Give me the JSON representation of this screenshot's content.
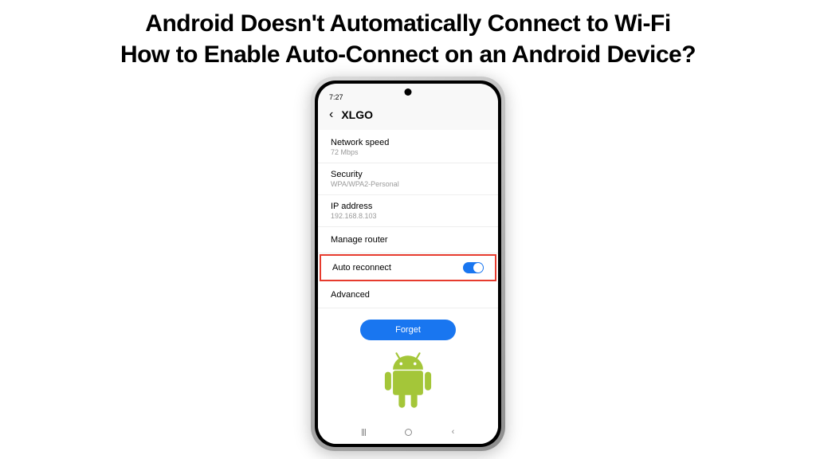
{
  "headline": {
    "line1": "Android Doesn't Automatically Connect to Wi-Fi",
    "line2": "How to Enable Auto-Connect on an Android Device?"
  },
  "phone": {
    "status_time": "7:27",
    "page_title": "XLGO",
    "rows": {
      "network_speed": {
        "label": "Network speed",
        "value": "72 Mbps"
      },
      "security": {
        "label": "Security",
        "value": "WPA/WPA2-Personal"
      },
      "ip_address": {
        "label": "IP address",
        "value": "192.168.8.103"
      },
      "manage_router": {
        "label": "Manage router"
      },
      "auto_reconnect": {
        "label": "Auto reconnect",
        "toggle_on": true
      },
      "advanced": {
        "label": "Advanced"
      }
    },
    "forget_button": "Forget"
  },
  "colors": {
    "highlight_border": "#e63b2e",
    "primary_blue": "#1976f0",
    "android_green": "#a4c639"
  }
}
